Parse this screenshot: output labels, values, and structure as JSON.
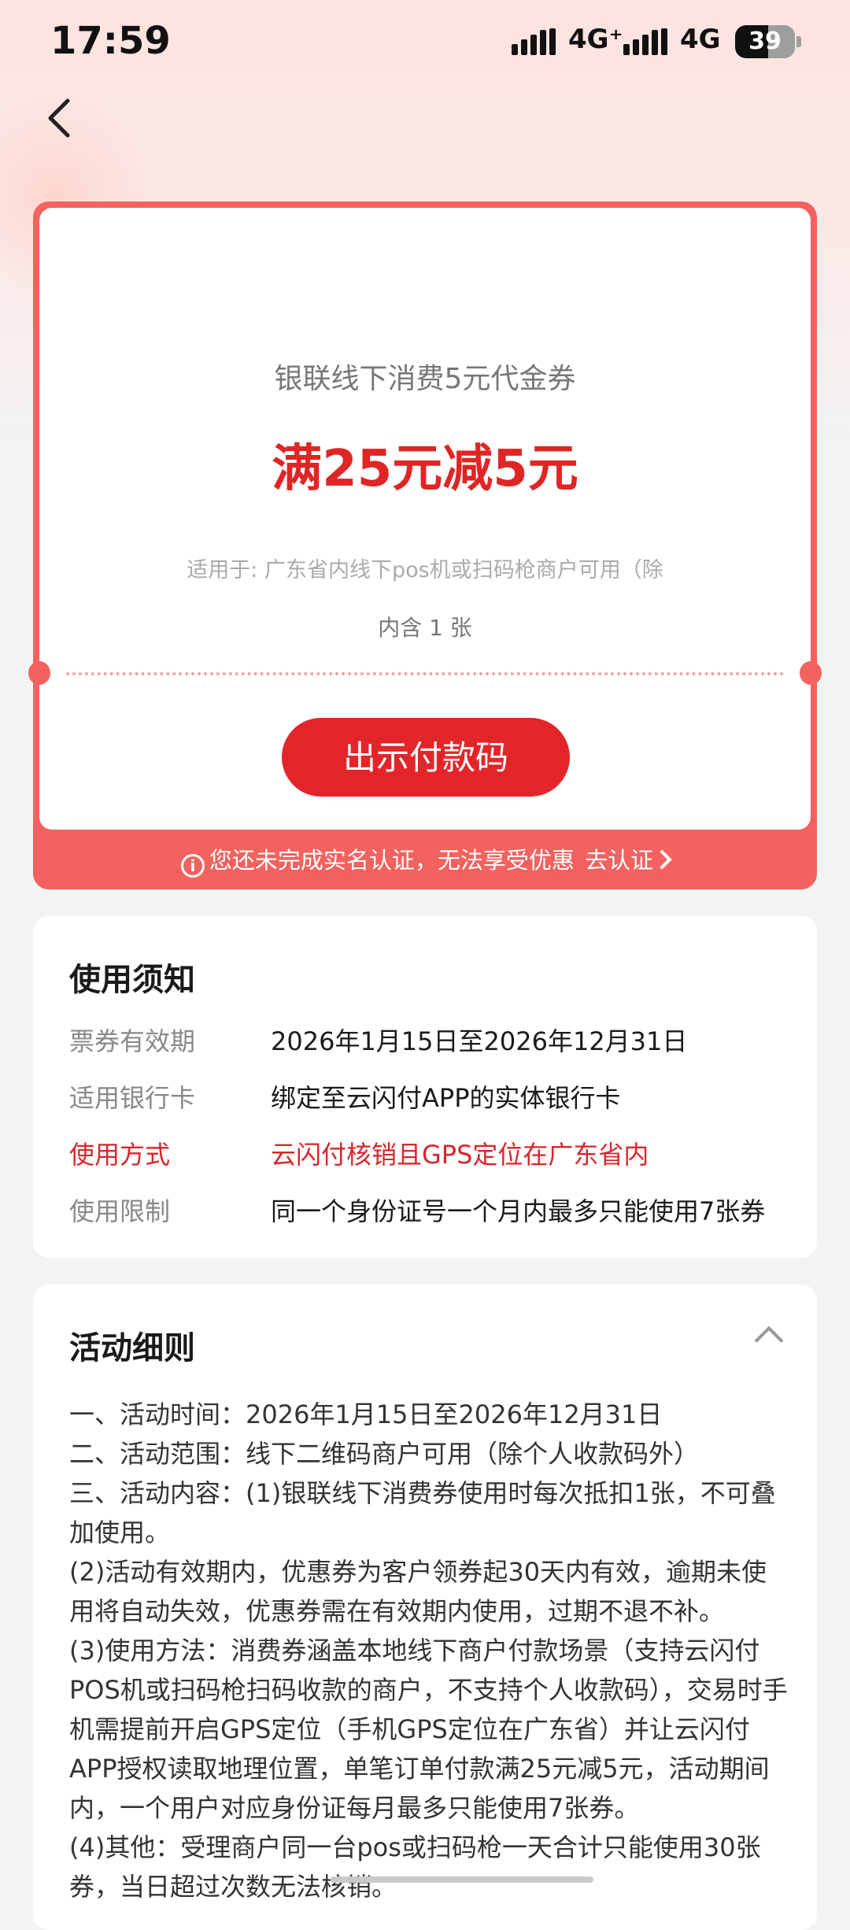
{
  "status_bar": {
    "time": "17:59",
    "network_1": "4G⁺",
    "network_2": "4G",
    "battery": "39"
  },
  "coupon": {
    "name": "银联线下消费5元代金券",
    "amount": "满25元减5元",
    "scope": "适用于: 广东省内线下pos机或扫码枪商户可用（除",
    "count": "内含 1 张",
    "pay_button": "出示付款码",
    "auth_notice": "您还未完成实名认证，无法享受优惠",
    "auth_link": "去认证"
  },
  "usage": {
    "title": "使用须知",
    "rows": [
      {
        "key": "票券有效期",
        "value": "2026年1月15日至2026年12月31日"
      },
      {
        "key": "适用银行卡",
        "value": "绑定至云闪付APP的实体银行卡"
      },
      {
        "key": "使用方式",
        "value": "云闪付核销且GPS定位在广东省内"
      },
      {
        "key": "使用限制",
        "value": "同一个身份证号一个月内最多只能使用7张券"
      }
    ]
  },
  "rules": {
    "title": "活动细则",
    "lines": [
      "一、活动时间：2026年1月15日至2026年12月31日",
      "二、活动范围：线下二维码商户可用（除个人收款码外）",
      "三、活动内容：(1)银联线下消费券使用时每次抵扣1张，不可叠加使用。",
      "(2)活动有效期内，优惠券为客户领券起30天内有效，逾期未使用将自动失效，优惠券需在有效期内使用，过期不退不补。",
      "(3)使用方法：消费券涵盖本地线下商户付款场景（支持云闪付POS机或扫码枪扫码收款的商户，不支持个人收款码），交易时手机需提前开启GPS定位（手机GPS定位在广东省）并让云闪付APP授权读取地理位置，单笔订单付款满25元减5元，活动期间内，一个用户对应身份证每月最多只能使用7张券。",
      "(4)其他：受理商户同一台pos或扫码枪一天合计只能使用30张券，当日超过次数无法核销。"
    ]
  }
}
